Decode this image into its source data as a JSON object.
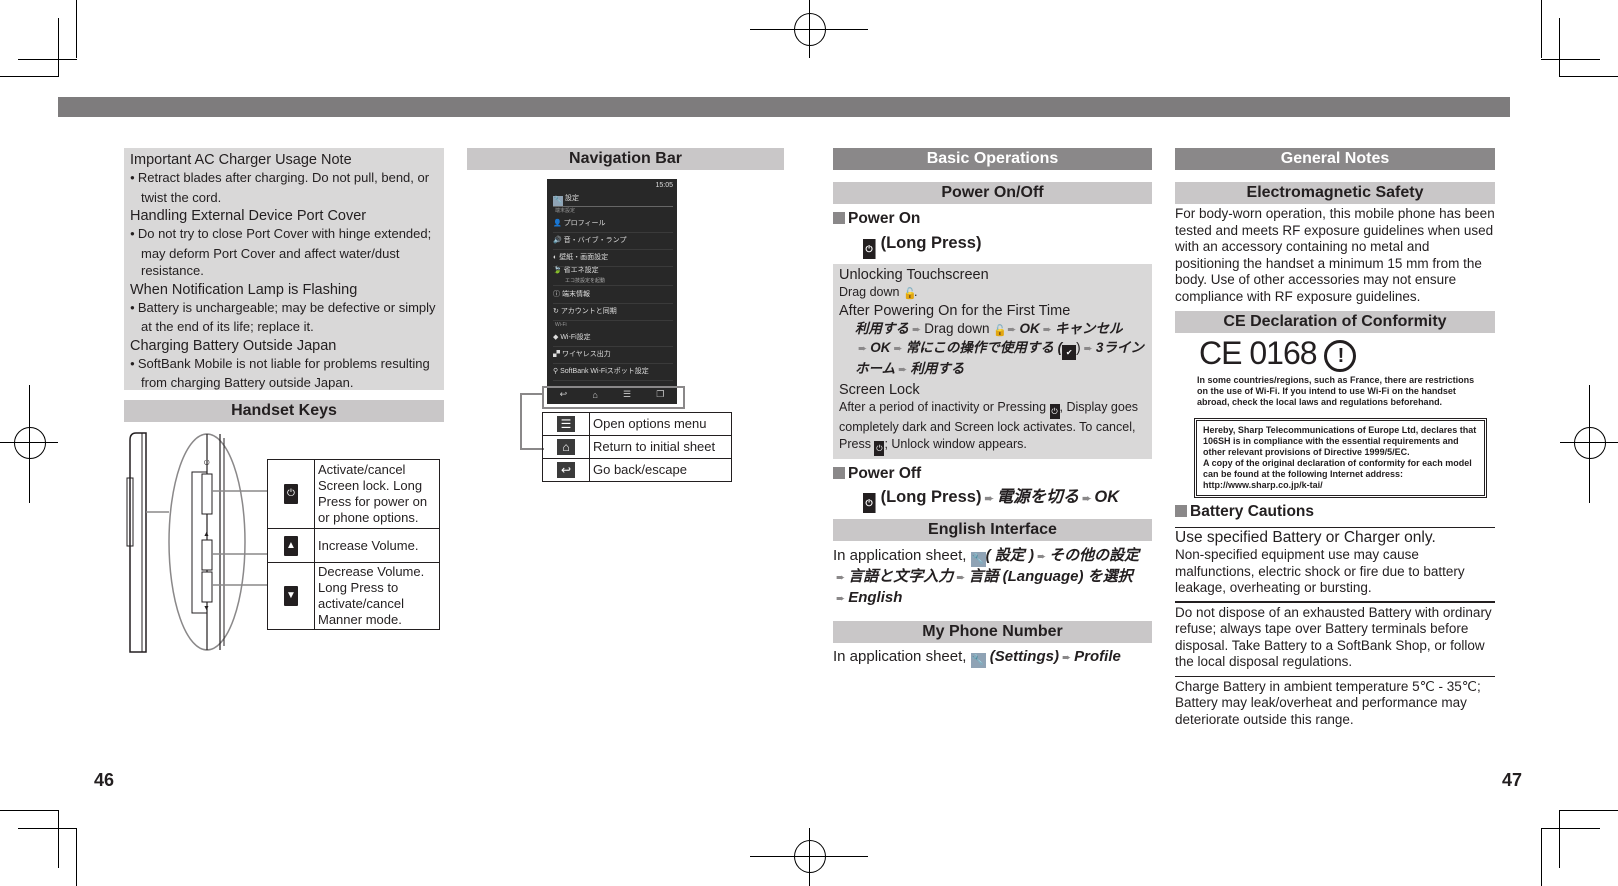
{
  "page_numbers": {
    "left": "46",
    "right": "47"
  },
  "left_page": {
    "notes": [
      {
        "title": "Important AC Charger Usage Note",
        "bullet": "Retract blades after charging. Do not pull, bend, or twist the cord."
      },
      {
        "title": "Handling External Device Port Cover",
        "bullet": "Do not try to close Port Cover with hinge extended; may deform Port Cover and affect water/dust resistance."
      },
      {
        "title": "When Notification Lamp is Flashing",
        "bullet": "Battery is unchargeable; may be defective or simply at the end of its life; replace it."
      },
      {
        "title": "Charging Battery Outside Japan",
        "bullet": "SoftBank Mobile is not liable for problems resulting from charging Battery outside Japan."
      }
    ],
    "handset_keys": {
      "heading": "Handset Keys",
      "keys": [
        {
          "icon": "power-icon",
          "glyph": "⏻",
          "description": "Activate/cancel Screen lock. Long Press for power on or phone options."
        },
        {
          "icon": "volume-up-icon",
          "glyph": "▲",
          "description": "Increase Volume."
        },
        {
          "icon": "volume-down-icon",
          "glyph": "▼",
          "description": "Decrease Volume. Long Press to activate/cancel Manner mode."
        }
      ]
    },
    "navigation_bar": {
      "heading": "Navigation Bar",
      "phone_screen": {
        "status_time": "15:05",
        "title": "設定",
        "section_device": "端末設定",
        "items": [
          {
            "label": "プロフィール"
          },
          {
            "label": "音・バイブ・ランプ"
          },
          {
            "label": "壁紙・画面設定"
          },
          {
            "label": "省エネ設定",
            "sub": "エコ技設定を起動"
          },
          {
            "label": "端末情報"
          },
          {
            "label": "アカウントと同期"
          }
        ],
        "section_wifi": "Wi-Fi",
        "wifi_items": [
          {
            "label": "Wi-Fi設定"
          },
          {
            "label": "ワイヤレス出力"
          },
          {
            "label": "SoftBank Wi-Fiスポット設定"
          }
        ]
      },
      "keys": [
        {
          "icon": "menu-icon",
          "glyph": "☰",
          "description": "Open options menu"
        },
        {
          "icon": "home-icon",
          "glyph": "⌂",
          "description": "Return to initial sheet"
        },
        {
          "icon": "back-icon",
          "glyph": "↩",
          "description": "Go back/escape"
        }
      ]
    }
  },
  "right_page": {
    "basic_operations": {
      "heading": "Basic Operations",
      "power_heading": "Power On/Off",
      "power_on": {
        "label": "Power On",
        "action": "(Long Press)"
      },
      "box": {
        "unlock_title": "Unlocking Touchscreen",
        "unlock_text_1": "Drag down",
        "unlock_text_2": ".",
        "first_time_title": "After Powering On for the First Time",
        "first_time_steps_1": "利用する",
        "first_time_drag": "Drag down",
        "first_time_ok": "OK",
        "first_time_cancel_1": "キャン",
        "first_time_cancel_2": "セル",
        "first_time_ok2": "OK",
        "first_time_always": "常にこの操作で使用する (",
        "first_time_close": ")",
        "first_time_home": "3ラインホーム",
        "first_time_use": "利用する",
        "screen_lock_title": "Screen Lock",
        "screen_lock_1": "After a period of inactivity or Pressing",
        "screen_lock_2": ", Display goes completely dark and Screen lock activates.",
        "screen_lock_3": "To cancel, Press",
        "screen_lock_4": "; Unlock window appears."
      },
      "power_off": {
        "label": "Power Off",
        "action": "(Long Press)",
        "step1": "電源を切る",
        "step2": "OK"
      }
    },
    "english_interface": {
      "heading": "English Interface",
      "prefix": "In application sheet,",
      "step_settings": "( 設定 )",
      "step_other": "その他の設定",
      "step_lang_input": "言語と文字入力",
      "step_lang": "言語 (Language) を選択",
      "step_english": "English"
    },
    "my_phone_number": {
      "heading": "My Phone Number",
      "prefix": "In application sheet,",
      "step_settings": "(Settings)",
      "step_profile": "Profile"
    },
    "general_notes": {
      "heading": "General Notes",
      "em_heading": "Electromagnetic Safety",
      "em_text": "For body-worn operation, this mobile phone has been tested and meets RF exposure guidelines when used with an accessory containing no metal and positioning the handset a minimum 15 mm from the body. Use of other accessories may not ensure compliance with RF exposure guidelines.",
      "ce_heading": "CE Declaration of Conformity",
      "ce_mark": "CE 0168",
      "ce_alert": "!",
      "wifi_note": "In some countries/regions, such as France, there are restrictions on the use of Wi-Fi. If you intend to use Wi-Fi on the handset abroad, check the local laws and regulations beforehand.",
      "declaration": [
        "Hereby, Sharp Telecommunications of Europe Ltd, declares that 106SH is in compliance with the essential requirements and other relevant provisions of Directive 1999/5/EC.",
        "A copy of the original declaration of conformity for each model can be found at the following Internet address:",
        "http://www.sharp.co.jp/k-tai/"
      ],
      "battery_heading": "Battery Cautions",
      "battery_items": [
        {
          "title": "Use specified Battery or Charger only.",
          "text": "Non-specified equipment use may cause malfunctions, electric shock or fire due to battery leakage, overheating or bursting."
        },
        {
          "title": "",
          "text": "Do not dispose of an exhausted Battery with ordinary refuse; always tape over Battery terminals before disposal. Take Battery to a SoftBank Shop, or follow the local disposal regulations."
        },
        {
          "title": "",
          "text": "Charge Battery in ambient temperature 5℃ - 35℃; Battery may leak/overheat and performance may deteriorate outside this range."
        }
      ]
    }
  },
  "colors": {
    "header_dark": "#8a8889",
    "header_light": "#c9c7c8",
    "note_bg": "#d9d8d8",
    "top_bar": "#7e7c7d"
  }
}
